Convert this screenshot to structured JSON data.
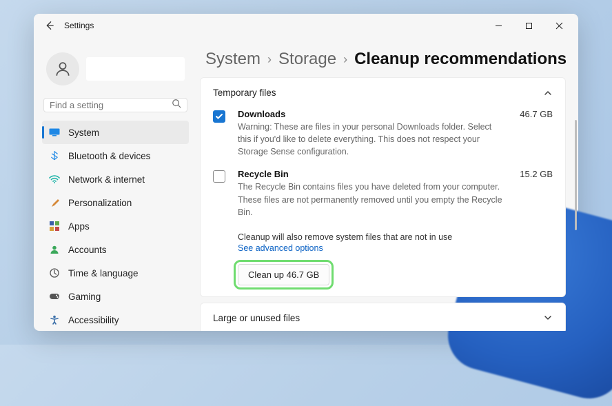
{
  "window": {
    "title": "Settings"
  },
  "search": {
    "placeholder": "Find a setting"
  },
  "nav": {
    "items": [
      {
        "label": "System"
      },
      {
        "label": "Bluetooth & devices"
      },
      {
        "label": "Network & internet"
      },
      {
        "label": "Personalization"
      },
      {
        "label": "Apps"
      },
      {
        "label": "Accounts"
      },
      {
        "label": "Time & language"
      },
      {
        "label": "Gaming"
      },
      {
        "label": "Accessibility"
      }
    ]
  },
  "breadcrumb": {
    "level1": "System",
    "level2": "Storage",
    "current": "Cleanup recommendations"
  },
  "sections": {
    "temp": {
      "title": "Temporary files",
      "items": [
        {
          "title": "Downloads",
          "size": "46.7 GB",
          "desc": "Warning: These are files in your personal Downloads folder. Select this if you'd like to delete everything. This does not respect your Storage Sense configuration."
        },
        {
          "title": "Recycle Bin",
          "size": "15.2 GB",
          "desc": "The Recycle Bin contains files you have deleted from your computer. These files are not permanently removed until you empty the Recycle Bin."
        }
      ],
      "note": "Cleanup will also remove system files that are not in use",
      "advanced": "See advanced options",
      "cleanup_button": "Clean up 46.7 GB"
    },
    "large": {
      "title": "Large or unused files"
    }
  }
}
